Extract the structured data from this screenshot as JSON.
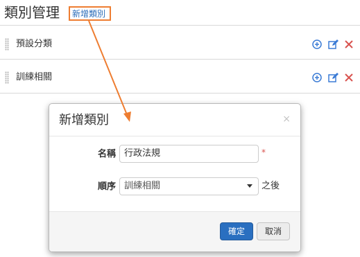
{
  "page": {
    "title": "類別管理",
    "add_link_label": "新增類別"
  },
  "categories": [
    {
      "label": "預設分類"
    },
    {
      "label": "訓練相關"
    }
  ],
  "row_action_icons": [
    "add-icon",
    "edit-icon",
    "delete-icon"
  ],
  "modal": {
    "title": "新增類別",
    "close_symbol": "×",
    "name_label": "名稱",
    "name_value": "行政法規",
    "required_mark": "*",
    "order_label": "順序",
    "order_selected": "訓練相關",
    "order_suffix": "之後",
    "confirm_label": "確定",
    "cancel_label": "取消"
  },
  "colors": {
    "highlight": "#ee7d31",
    "link": "#2a6cb8",
    "icon_blue": "#3a7bd5",
    "icon_red": "#d9534f",
    "primary_button": "#2a6fc0"
  }
}
